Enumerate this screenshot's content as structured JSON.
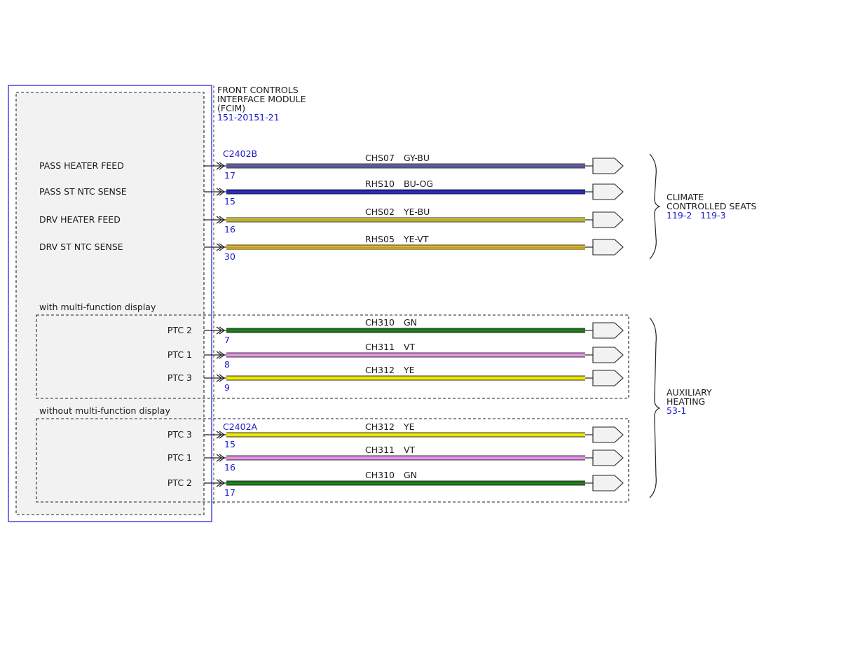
{
  "module": {
    "title_lines": [
      "FRONT CONTROLS",
      "INTERFACE MODULE",
      "(FCIM)"
    ],
    "ref": "151-20151-21"
  },
  "connectors": {
    "c1": "C2402B",
    "c2": "C2402A"
  },
  "sections": {
    "with_mfd": "with multi-function display",
    "without_mfd": "without multi-function display"
  },
  "circuits": [
    {
      "label": "PASS HEATER FEED",
      "pin": "17",
      "circuit": "CHS07",
      "color_code": "GY-BU",
      "stripes": [
        "#6a6a88",
        "#4a4acc",
        "#6a6a88"
      ]
    },
    {
      "label": "PASS ST NTC SENSE",
      "pin": "15",
      "circuit": "RHS10",
      "color_code": "BU-OG",
      "stripes": [
        "#1a1aa8",
        "#3838dd",
        "#1a1aa8"
      ]
    },
    {
      "label": "DRV HEATER FEED",
      "pin": "16",
      "circuit": "CHS02",
      "color_code": "YE-BU",
      "stripes": [
        "#e8d400",
        "#8a8aaa",
        "#e8d400"
      ]
    },
    {
      "label": "DRV ST NTC SENSE",
      "pin": "30",
      "circuit": "RHS05",
      "color_code": "YE-VT",
      "stripes": [
        "#e8cc00",
        "#c89050",
        "#e8cc00"
      ]
    },
    {
      "label": "PTC 2",
      "pin": "7",
      "circuit": "CH310",
      "color_code": "GN",
      "stripes": [
        "#157015",
        "#1c8c1c",
        "#157015"
      ]
    },
    {
      "label": "PTC 1",
      "pin": "8",
      "circuit": "CH311",
      "color_code": "VT",
      "stripes": [
        "#dd88dd",
        "#ee99ee",
        "#dd88dd"
      ]
    },
    {
      "label": "PTC 3",
      "pin": "9",
      "circuit": "CH312",
      "color_code": "YE",
      "stripes": [
        "#e8e000",
        "#f5ee00",
        "#e8e000"
      ]
    },
    {
      "label": "PTC 3",
      "pin": "15",
      "circuit": "CH312",
      "color_code": "YE",
      "stripes": [
        "#e8e000",
        "#f5ee00",
        "#e8e000"
      ]
    },
    {
      "label": "PTC 1",
      "pin": "16",
      "circuit": "CH311",
      "color_code": "VT",
      "stripes": [
        "#dd88dd",
        "#ee99ee",
        "#dd88dd"
      ]
    },
    {
      "label": "PTC 2",
      "pin": "17",
      "circuit": "CH310",
      "color_code": "GN",
      "stripes": [
        "#157015",
        "#1c8c1c",
        "#157015"
      ]
    }
  ],
  "groups": {
    "seats": {
      "title_lines": [
        "CLIMATE",
        "CONTROLLED SEATS"
      ],
      "refs": "119-2   119-3"
    },
    "aux": {
      "title_lines": [
        "AUXILIARY",
        "HEATING"
      ],
      "refs": "53-1"
    }
  }
}
